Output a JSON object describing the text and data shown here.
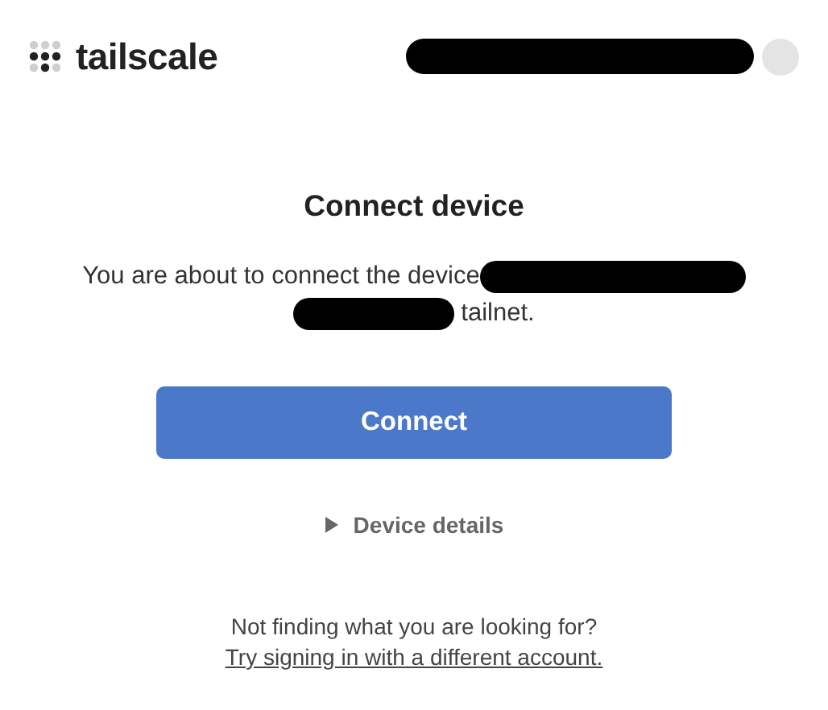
{
  "header": {
    "logo_text": "tailscale"
  },
  "title": "Connect device",
  "message": {
    "line_1": "You are about to connect the device",
    "line_2": "tailnet."
  },
  "connect_button": "Connect",
  "details": {
    "label": "Device details",
    "expanded": false
  },
  "footer": {
    "question": "Not finding what you are looking for?",
    "link": "Try signing in with a different account."
  }
}
